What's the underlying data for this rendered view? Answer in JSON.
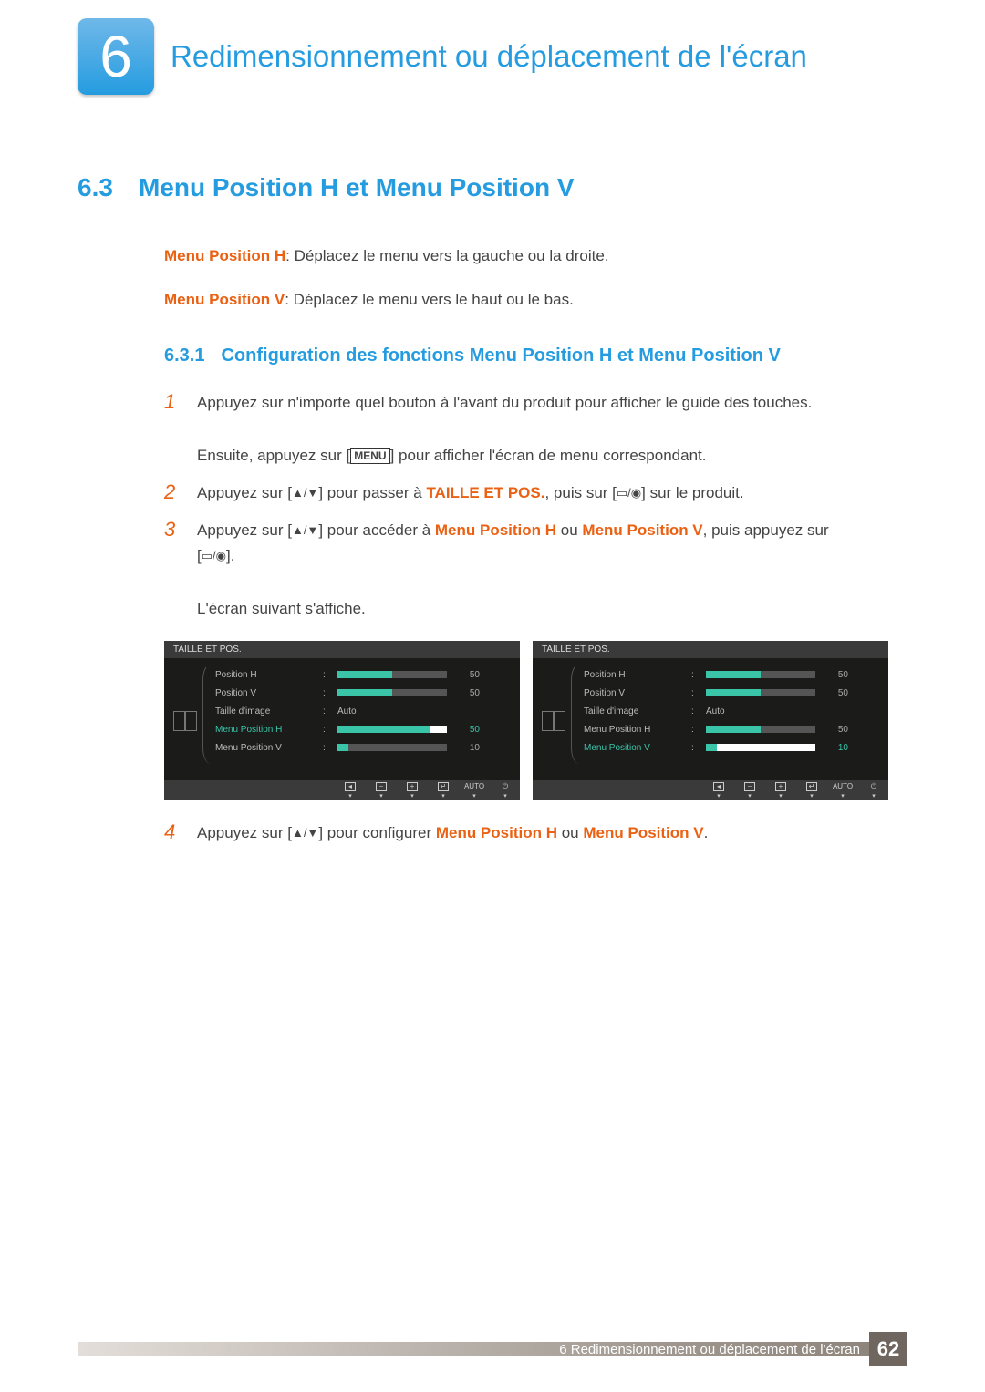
{
  "chapter": {
    "number": "6",
    "title": "Redimensionnement ou déplacement de l'écran"
  },
  "section": {
    "number": "6.3",
    "title": "Menu Position H et Menu Position V"
  },
  "desc": {
    "mph_label": "Menu Position H",
    "mph_text": ": Déplacez le menu vers la gauche ou la droite.",
    "mpv_label": "Menu Position V",
    "mpv_text": ": Déplacez le menu vers le haut ou le bas."
  },
  "subsection": {
    "number": "6.3.1",
    "title": "Configuration des fonctions Menu Position H et Menu Position V"
  },
  "steps": {
    "s1a": "Appuyez sur n'importe quel bouton à l'avant du produit pour afficher le guide des touches.",
    "s1b_pre": "Ensuite, appuyez sur [",
    "s1b_menu": "MENU",
    "s1b_post": "] pour afficher l'écran de menu correspondant.",
    "s2_pre": "Appuyez sur [",
    "s2_mid": "] pour passer à ",
    "s2_target": "TAILLE ET POS.",
    "s2_post1": ", puis sur [",
    "s2_post2": "] sur le produit.",
    "s3_pre": "Appuyez sur [",
    "s3_mid": "] pour accéder à ",
    "s3_a": "Menu Position H",
    "s3_or": " ou ",
    "s3_b": "Menu Position V",
    "s3_post1": ", puis appuyez sur",
    "s3_post2": "[",
    "s3_post3": "].",
    "s3_line2": "L'écran suivant s'affiche.",
    "s4_pre": "Appuyez sur [",
    "s4_mid": "] pour configurer ",
    "s4_a": "Menu Position H",
    "s4_or": " ou ",
    "s4_b": "Menu Position V",
    "s4_post": "."
  },
  "osd": {
    "title": "TAILLE ET POS.",
    "rows": {
      "ph": {
        "name": "Position H",
        "val": "50"
      },
      "pv": {
        "name": "Position V",
        "val": "50"
      },
      "ti": {
        "name": "Taille d'image",
        "val": "Auto"
      },
      "mph": {
        "name": "Menu Position H",
        "val": "50"
      },
      "mpv": {
        "name": "Menu Position V",
        "val": "10"
      }
    },
    "footer": {
      "auto": "AUTO"
    }
  },
  "footer": {
    "text": "6 Redimensionnement ou déplacement de l'écran",
    "page": "62"
  }
}
